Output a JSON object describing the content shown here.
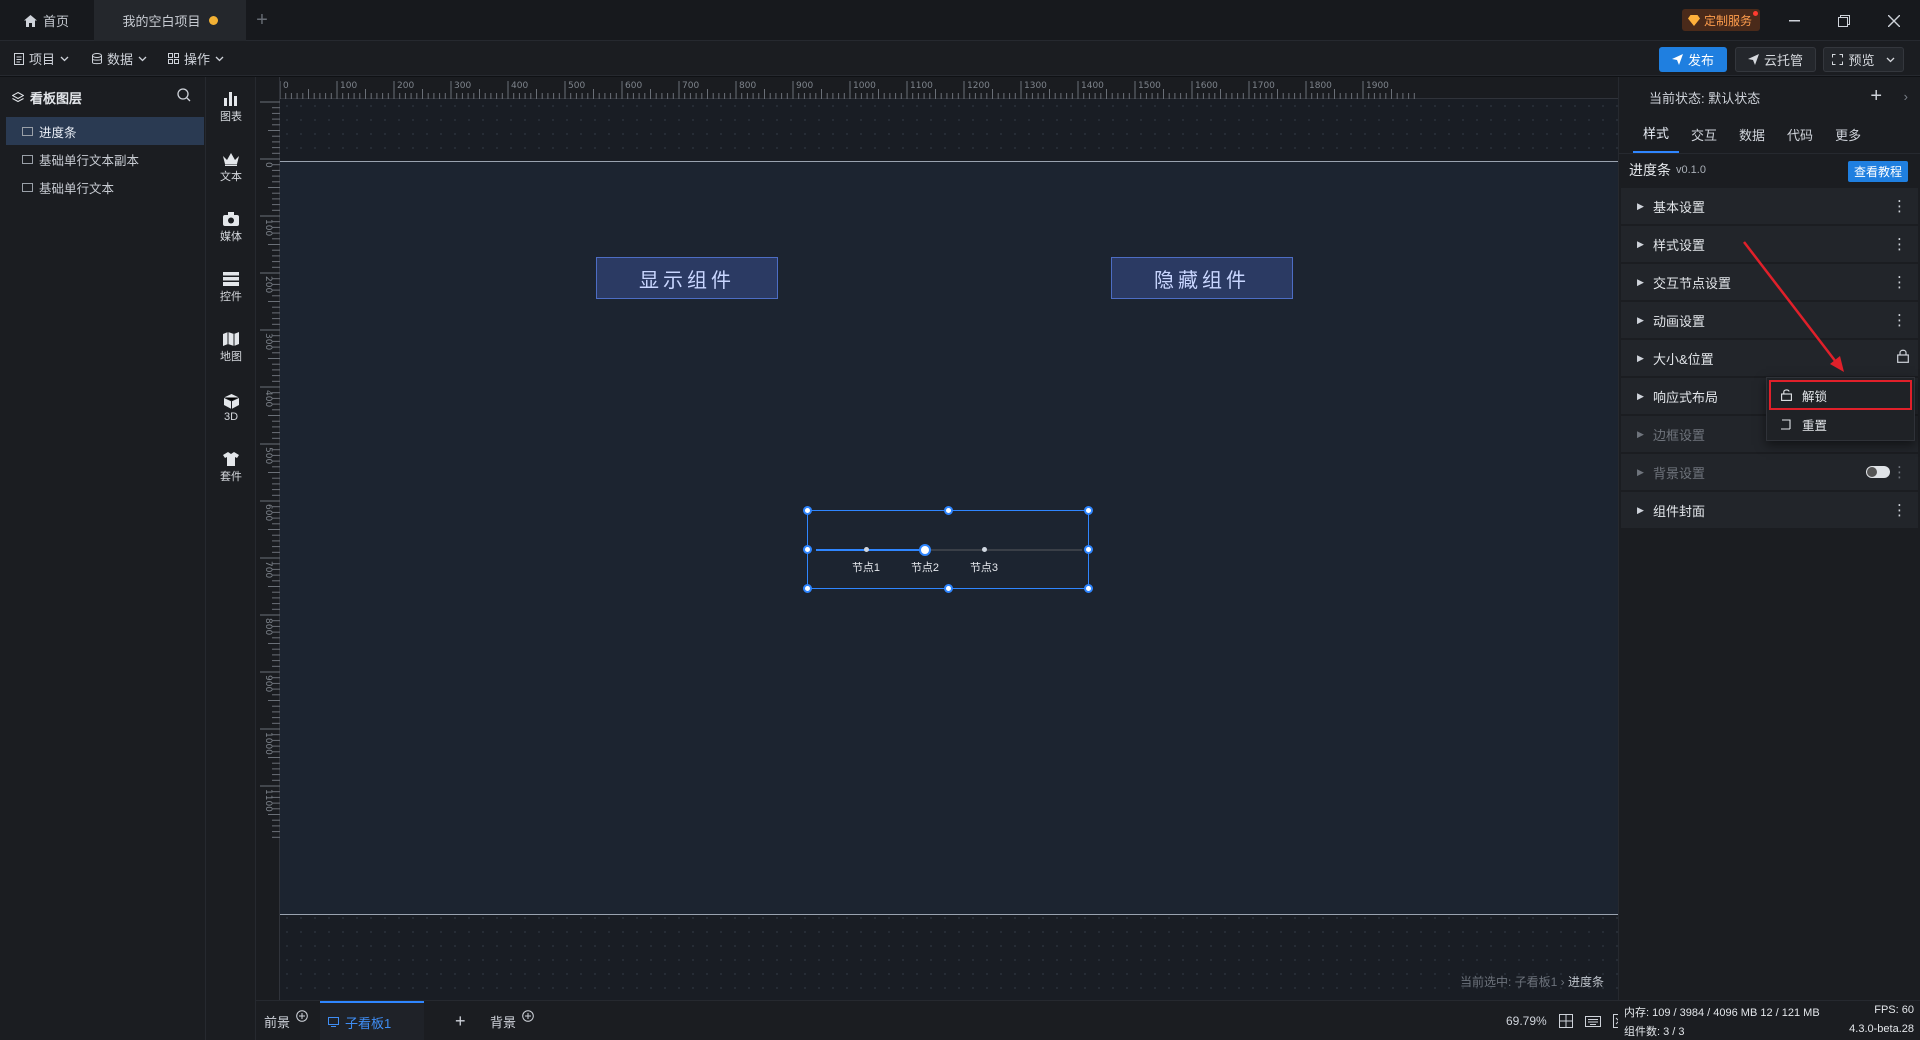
{
  "titlebar": {
    "home_tab": "首页",
    "project_tab": "我的空白项目",
    "custom_service": "定制服务"
  },
  "toolbar": {
    "menu_project": "项目",
    "menu_data": "数据",
    "menu_operate": "操作",
    "publish": "发布",
    "cloud": "云托管",
    "preview": "预览"
  },
  "layers": {
    "title": "看板图层",
    "items": [
      "进度条",
      "基础单行文本副本",
      "基础单行文本"
    ]
  },
  "strip": {
    "items": [
      "图表",
      "文本",
      "媒体",
      "控件",
      "地图",
      "3D",
      "套件"
    ]
  },
  "ruler": {
    "h_labels": [
      "0",
      "100",
      "200",
      "300",
      "400",
      "500",
      "600",
      "700",
      "800",
      "900",
      "1000",
      "1100",
      "1200",
      "1300",
      "1400",
      "1500",
      "1600",
      "1700",
      "1800",
      "1900"
    ],
    "v_labels": [
      "0",
      "100",
      "200",
      "300",
      "400",
      "500",
      "600",
      "700",
      "800",
      "900",
      "1000",
      "1100"
    ]
  },
  "canvas": {
    "show_button": "显示组件",
    "hide_button": "隐藏组件",
    "progress": {
      "nodes": [
        "节点1",
        "节点2",
        "节点3"
      ],
      "current_index": 1,
      "fill_fraction": 0.41
    },
    "selected_prefix": "当前选中: 子看板1 › ",
    "selected_name": "进度条"
  },
  "bottombar": {
    "front": "前景",
    "sub_board": "子看板1",
    "background": "背景",
    "zoom": "69.79%"
  },
  "rpanel": {
    "state_label": "当前状态:  默认状态",
    "tabs": [
      "样式",
      "交互",
      "数据",
      "代码",
      "更多"
    ],
    "component_name": "进度条",
    "component_version": "v0.1.0",
    "tutorial": "查看教程",
    "sections": [
      "基本设置",
      "样式设置",
      "交互节点设置",
      "动画设置",
      "大小&位置",
      "响应式布局",
      "边框设置",
      "背景设置",
      "组件封面"
    ]
  },
  "dropdown": {
    "unlock": "解锁",
    "reset": "重置"
  },
  "status": {
    "memory": "内存:  109 / 3984 / 4096 MB  12 / 121 MB",
    "fps": "FPS:   60",
    "count": "组件数: 3 / 3",
    "version": "4.3.0-beta.28"
  },
  "colors": {
    "accent": "#2f86ff",
    "highlight_red": "#e0202a"
  }
}
